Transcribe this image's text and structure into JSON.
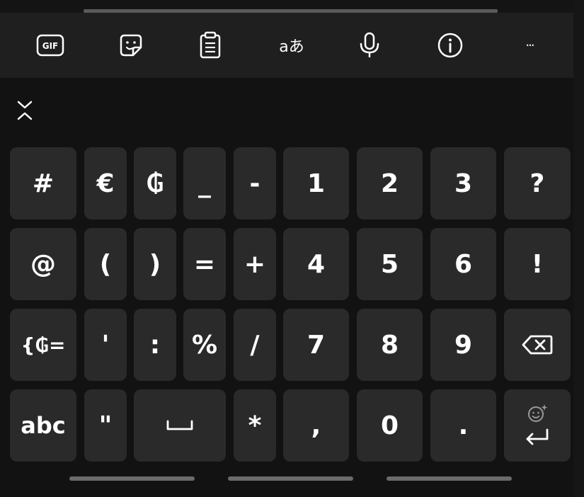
{
  "toolbar": {
    "gif_label": "GIF",
    "translate_label": "aあ",
    "more_label": "···"
  },
  "keyboard": {
    "row1": [
      "#",
      "€",
      "₲",
      "_",
      "-",
      "1",
      "2",
      "3",
      "?"
    ],
    "row2": [
      "@",
      "(",
      ")",
      "=",
      "+",
      "4",
      "5",
      "6",
      "!"
    ],
    "row3": [
      "{₲=",
      "'",
      ":",
      "%",
      "/",
      "7",
      "8",
      "9"
    ],
    "row4": [
      "abc",
      "\"",
      "*",
      ",",
      "0",
      "."
    ]
  },
  "colors": {
    "background": "#121212",
    "toolbar": "#1f1f1f",
    "key": "#2a2a2a",
    "text": "#ffffff"
  }
}
